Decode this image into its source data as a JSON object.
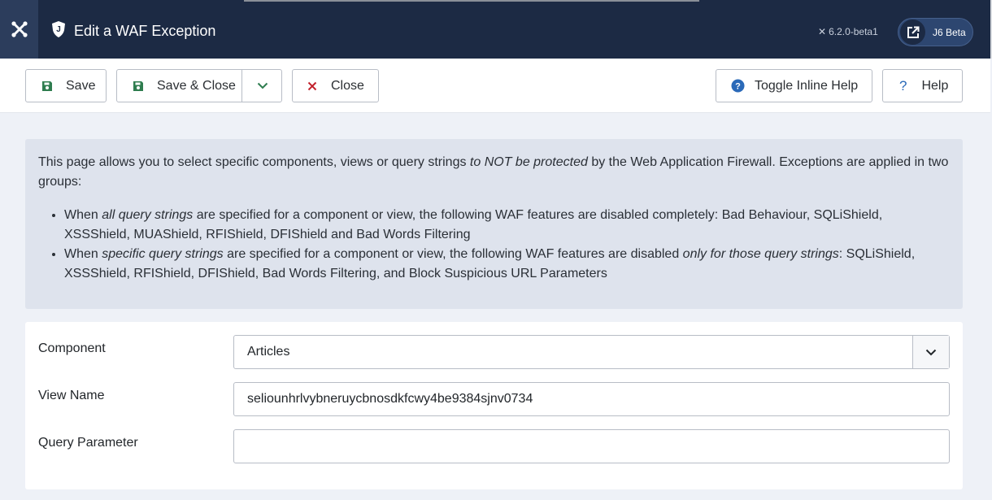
{
  "header": {
    "title": "Edit a WAF Exception",
    "version": "6.2.0-beta1",
    "beta_label": "J6 Beta"
  },
  "toolbar": {
    "save_label": "Save",
    "save_close_label": "Save & Close",
    "close_label": "Close",
    "toggle_help_label": "Toggle Inline Help",
    "help_label": "Help"
  },
  "info": {
    "intro_before": "This page allows you to select specific components, views or query strings ",
    "intro_emph": "to NOT be protected",
    "intro_after": " by the Web Application Firewall. Exceptions are applied in two groups:",
    "item1_before": "When ",
    "item1_emph": "all query strings",
    "item1_after": " are specified for a component or view, the following WAF features are disabled completely: Bad Behaviour, SQLiShield, XSSShield, MUAShield, RFIShield, DFIShield and Bad Words Filtering",
    "item2_before": "When ",
    "item2_emph": "specific query strings",
    "item2_mid": " are specified for a component or view, the following WAF features are disabled ",
    "item2_emph2": "only for those query strings",
    "item2_after": ": SQLiShield, XSSShield, RFIShield, DFIShield, Bad Words Filtering, and Block Suspicious URL Parameters"
  },
  "form": {
    "component_label": "Component",
    "component_value": "Articles",
    "view_label": "View Name",
    "view_value": "seliounhrlvybneruycbnosdkfcwy4be9384sjnv0734",
    "query_label": "Query Parameter",
    "query_value": ""
  },
  "colors": {
    "header_bg": "#1c2a44",
    "save_icon": "#2f7d4f",
    "close_icon": "#c2202b",
    "help_icon": "#2a69b8"
  },
  "icons": {
    "logo": "joomla-logo-icon",
    "title": "shield-icon",
    "save": "floppy-disk-icon",
    "close": "close-x-icon",
    "toggle_help": "question-circle-icon",
    "help": "question-mark-icon",
    "external": "external-link-icon",
    "dropdown": "chevron-down-icon"
  }
}
